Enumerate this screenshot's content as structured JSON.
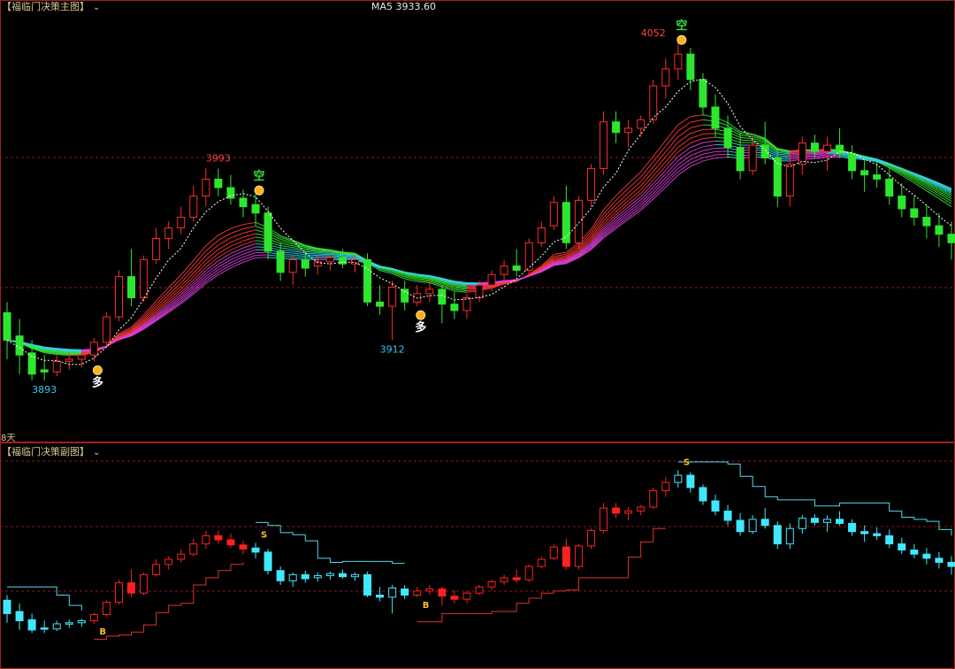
{
  "main_panel": {
    "title": "【福临门决策主图】",
    "ma_label": "MA5 3933.60",
    "period_label": "8天"
  },
  "sub_panel": {
    "title": "【福临门决策副图】"
  },
  "colors": {
    "up": "#ff2a2a",
    "down": "#2ee62e",
    "sub_up": "#ff2020",
    "sub_down": "#40e8ff",
    "grid": "#8a1a1a",
    "frame": "#a02020",
    "ma": "#ffffff"
  },
  "chart_data": {
    "type": "candlestick",
    "ylim": [
      3870,
      4060
    ],
    "annotations": [
      {
        "label": "3893",
        "kind": "low",
        "bar": 3,
        "value": 3893,
        "color": "#34c6ee"
      },
      {
        "label": "3993",
        "kind": "high",
        "bar": 17,
        "value": 3993,
        "color": "#ff4040"
      },
      {
        "label": "3912",
        "kind": "low",
        "bar": 31,
        "value": 3912,
        "color": "#34c6ee"
      },
      {
        "label": "4052",
        "kind": "high",
        "bar": 52,
        "value": 4052,
        "color": "#ff4040"
      }
    ],
    "signals_main": [
      {
        "text": "多",
        "bar": 7,
        "type": "buy"
      },
      {
        "text": "空",
        "bar": 20,
        "type": "sell"
      },
      {
        "text": "多",
        "bar": 33,
        "type": "buy"
      },
      {
        "text": "空",
        "bar": 54,
        "type": "sell"
      }
    ],
    "signals_sub": [
      {
        "text": "B",
        "bar": 7
      },
      {
        "text": "S",
        "bar": 20
      },
      {
        "text": "B",
        "bar": 33
      },
      {
        "text": "S",
        "bar": 54
      }
    ],
    "ohlc": [
      [
        3925,
        3930,
        3903,
        3912
      ],
      [
        3914,
        3922,
        3896,
        3905
      ],
      [
        3906,
        3912,
        3893,
        3896
      ],
      [
        3898,
        3905,
        3893,
        3897
      ],
      [
        3897,
        3905,
        3895,
        3902
      ],
      [
        3902,
        3906,
        3898,
        3903
      ],
      [
        3903,
        3907,
        3899,
        3905
      ],
      [
        3905,
        3913,
        3902,
        3911
      ],
      [
        3911,
        3925,
        3909,
        3923
      ],
      [
        3923,
        3945,
        3921,
        3942
      ],
      [
        3942,
        3955,
        3928,
        3932
      ],
      [
        3932,
        3952,
        3930,
        3950
      ],
      [
        3950,
        3965,
        3948,
        3960
      ],
      [
        3960,
        3968,
        3955,
        3965
      ],
      [
        3965,
        3975,
        3962,
        3970
      ],
      [
        3970,
        3985,
        3968,
        3980
      ],
      [
        3980,
        3993,
        3975,
        3988
      ],
      [
        3988,
        3993,
        3980,
        3984
      ],
      [
        3984,
        3990,
        3976,
        3979
      ],
      [
        3979,
        3983,
        3970,
        3975
      ],
      [
        3976,
        3981,
        3966,
        3972
      ],
      [
        3972,
        3975,
        3950,
        3954
      ],
      [
        3954,
        3958,
        3940,
        3944
      ],
      [
        3944,
        3952,
        3938,
        3950
      ],
      [
        3950,
        3954,
        3942,
        3946
      ],
      [
        3947,
        3952,
        3943,
        3949
      ],
      [
        3949,
        3953,
        3945,
        3951
      ],
      [
        3951,
        3955,
        3946,
        3948
      ],
      [
        3948,
        3952,
        3944,
        3950
      ],
      [
        3950,
        3953,
        3928,
        3930
      ],
      [
        3930,
        3938,
        3924,
        3928
      ],
      [
        3928,
        3940,
        3912,
        3937
      ],
      [
        3936,
        3940,
        3926,
        3930
      ],
      [
        3930,
        3938,
        3928,
        3934
      ],
      [
        3934,
        3940,
        3930,
        3936
      ],
      [
        3936,
        3938,
        3920,
        3929
      ],
      [
        3929,
        3935,
        3922,
        3926
      ],
      [
        3926,
        3934,
        3922,
        3932
      ],
      [
        3932,
        3940,
        3930,
        3938
      ],
      [
        3938,
        3945,
        3935,
        3943
      ],
      [
        3943,
        3950,
        3940,
        3947
      ],
      [
        3947,
        3955,
        3942,
        3945
      ],
      [
        3945,
        3960,
        3943,
        3958
      ],
      [
        3958,
        3968,
        3956,
        3965
      ],
      [
        3966,
        3980,
        3964,
        3977
      ],
      [
        3977,
        3985,
        3955,
        3958
      ],
      [
        3958,
        3980,
        3955,
        3978
      ],
      [
        3978,
        3995,
        3975,
        3993
      ],
      [
        3993,
        4020,
        3990,
        4015
      ],
      [
        4015,
        4020,
        4005,
        4010
      ],
      [
        4010,
        4016,
        4003,
        4012
      ],
      [
        4012,
        4018,
        4008,
        4016
      ],
      [
        4016,
        4035,
        4014,
        4032
      ],
      [
        4032,
        4045,
        4026,
        4040
      ],
      [
        4040,
        4052,
        4035,
        4047
      ],
      [
        4047,
        4050,
        4030,
        4035
      ],
      [
        4035,
        4038,
        4018,
        4022
      ],
      [
        4022,
        4028,
        4008,
        4012
      ],
      [
        4012,
        4018,
        3998,
        4003
      ],
      [
        4003,
        4010,
        3988,
        3992
      ],
      [
        3992,
        4008,
        3990,
        4004
      ],
      [
        4004,
        4015,
        3995,
        3998
      ],
      [
        3998,
        4002,
        3975,
        3980
      ],
      [
        3980,
        4000,
        3975,
        3995
      ],
      [
        3995,
        4008,
        3990,
        4005
      ],
      [
        4005,
        4009,
        3998,
        4001
      ],
      [
        4001,
        4008,
        3992,
        4004
      ],
      [
        4004,
        4012,
        3998,
        4000
      ],
      [
        4000,
        4004,
        3988,
        3992
      ],
      [
        3992,
        3998,
        3982,
        3990
      ],
      [
        3990,
        3996,
        3984,
        3988
      ],
      [
        3988,
        3994,
        3976,
        3980
      ],
      [
        3980,
        3986,
        3970,
        3974
      ],
      [
        3974,
        3980,
        3966,
        3970
      ],
      [
        3970,
        3976,
        3960,
        3966
      ],
      [
        3966,
        3972,
        3956,
        3962
      ],
      [
        3962,
        3968,
        3950,
        3958
      ]
    ]
  }
}
